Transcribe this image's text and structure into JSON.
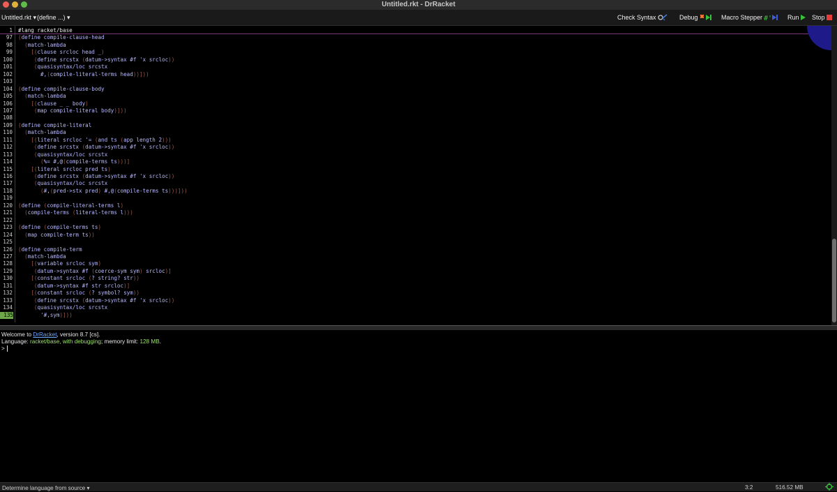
{
  "window": {
    "title": "Untitled.rkt - DrRacket"
  },
  "toolbar": {
    "file_menu": "Untitled.rkt",
    "define_menu": "(define ...)",
    "check_syntax": "Check Syntax",
    "debug": "Debug",
    "macro_stepper": "Macro Stepper",
    "run": "Run",
    "stop": "Stop"
  },
  "editor": {
    "lines": [
      {
        "n": "1",
        "text": "#lang racket/base",
        "first": true
      },
      {
        "n": "97",
        "text": "(define compile-clause-head"
      },
      {
        "n": "98",
        "text": "  (match-lambda"
      },
      {
        "n": "99",
        "text": "    [(clause srcloc head _)"
      },
      {
        "n": "100",
        "text": "     (define srcstx (datum->syntax #f 'x srcloc))"
      },
      {
        "n": "101",
        "text": "     (quasisyntax/loc srcstx"
      },
      {
        "n": "102",
        "text": "       #,(compile-literal-terms head))]))"
      },
      {
        "n": "103",
        "text": ""
      },
      {
        "n": "104",
        "text": "(define compile-clause-body"
      },
      {
        "n": "105",
        "text": "  (match-lambda"
      },
      {
        "n": "106",
        "text": "    [(clause _ _ body)"
      },
      {
        "n": "107",
        "text": "     (map compile-literal body)]))"
      },
      {
        "n": "108",
        "text": ""
      },
      {
        "n": "109",
        "text": "(define compile-literal"
      },
      {
        "n": "110",
        "text": "  (match-lambda"
      },
      {
        "n": "111",
        "text": "    [(literal srcloc '= (and ts (app length 2)))"
      },
      {
        "n": "112",
        "text": "     (define srcstx (datum->syntax #f 'x srcloc))"
      },
      {
        "n": "113",
        "text": "     (quasisyntax/loc srcstx"
      },
      {
        "n": "114",
        "text": "       (%= #,@(compile-terms ts)))]"
      },
      {
        "n": "115",
        "text": "    [(literal srcloc pred ts)"
      },
      {
        "n": "116",
        "text": "     (define srcstx (datum->syntax #f 'x srcloc))"
      },
      {
        "n": "117",
        "text": "     (quasisyntax/loc srcstx"
      },
      {
        "n": "118",
        "text": "       (#,(pred->stx pred) #,@(compile-terms ts)))]))"
      },
      {
        "n": "119",
        "text": ""
      },
      {
        "n": "120",
        "text": "(define (compile-literal-terms l)"
      },
      {
        "n": "121",
        "text": "  (compile-terms (literal-terms l)))"
      },
      {
        "n": "122",
        "text": ""
      },
      {
        "n": "123",
        "text": "(define (compile-terms ts)"
      },
      {
        "n": "124",
        "text": "  (map compile-term ts))"
      },
      {
        "n": "125",
        "text": ""
      },
      {
        "n": "126",
        "text": "(define compile-term"
      },
      {
        "n": "127",
        "text": "  (match-lambda"
      },
      {
        "n": "128",
        "text": "    [(variable srcloc sym)"
      },
      {
        "n": "129",
        "text": "     (datum->syntax #f (coerce-sym sym) srcloc)]"
      },
      {
        "n": "130",
        "text": "    [(constant srcloc (? string? str))"
      },
      {
        "n": "131",
        "text": "     (datum->syntax #f str srcloc)]"
      },
      {
        "n": "132",
        "text": "    [(constant srcloc (? symbol? sym))"
      },
      {
        "n": "133",
        "text": "     (define srcstx (datum->syntax #f 'x srcloc))"
      },
      {
        "n": "134",
        "text": "     (quasisyntax/loc srcstx"
      },
      {
        "n": "135",
        "text": "       '#,sym)]))",
        "current": true
      }
    ]
  },
  "repl": {
    "welcome_prefix": "Welcome to ",
    "welcome_link": "DrRacket",
    "welcome_suffix": ", version 8.7 [cs].",
    "language_label": "Language: ",
    "language_value": "racket/base, with debugging",
    "memory_label": "; memory limit: ",
    "memory_value": "128 MB",
    "memory_suffix": ".",
    "prompt": ">"
  },
  "status": {
    "language_menu": "Determine language from source",
    "position": "3:2",
    "memory": "516.52 MB"
  },
  "colors": {
    "code": "#b8b8ff",
    "paren": "#9a5a4a",
    "current_line": "#6fa84b",
    "link": "#6fa8ff",
    "accent_green": "#9ee26c"
  }
}
